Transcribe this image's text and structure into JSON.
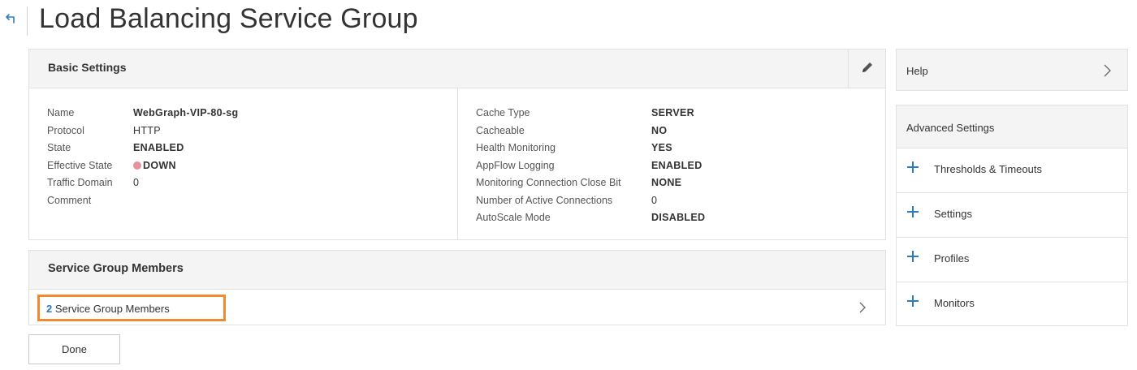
{
  "header": {
    "title": "Load Balancing Service Group"
  },
  "basic_settings": {
    "title": "Basic Settings",
    "left": [
      {
        "key": "Name",
        "value": "WebGraph-VIP-80-sg"
      },
      {
        "key": "Protocol",
        "value": "HTTP"
      },
      {
        "key": "State",
        "value": "ENABLED"
      },
      {
        "key": "Effective State",
        "value": "DOWN"
      },
      {
        "key": "Traffic Domain",
        "value": "0"
      },
      {
        "key": "Comment",
        "value": ""
      }
    ],
    "right": [
      {
        "key": "Cache Type",
        "value": "SERVER"
      },
      {
        "key": "Cacheable",
        "value": "NO"
      },
      {
        "key": "Health Monitoring",
        "value": "YES"
      },
      {
        "key": "AppFlow Logging",
        "value": "ENABLED"
      },
      {
        "key": "Monitoring Connection Close Bit",
        "value": "NONE"
      },
      {
        "key": "Number of Active Connections",
        "value": "0"
      },
      {
        "key": "AutoScale Mode",
        "value": "DISABLED"
      }
    ],
    "status_color": "#e8909c"
  },
  "members": {
    "title": "Service Group Members",
    "count": "2",
    "link_label": "Service Group Members"
  },
  "done_label": "Done",
  "help": {
    "title": "Help"
  },
  "advanced": {
    "title": "Advanced Settings",
    "items": [
      {
        "label": "Thresholds & Timeouts"
      },
      {
        "label": "Settings"
      },
      {
        "label": "Profiles"
      },
      {
        "label": "Monitors"
      }
    ]
  },
  "colors": {
    "accent": "#2a7bbf",
    "highlight": "#f0892f"
  }
}
